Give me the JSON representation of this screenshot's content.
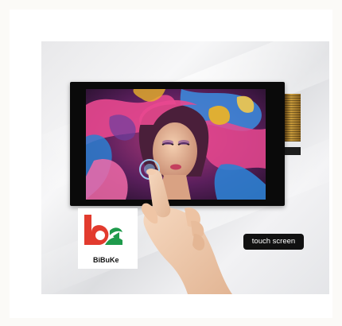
{
  "brand": {
    "name": "BiBuKe",
    "colors": {
      "red": "#e23b2e",
      "green": "#1e9a4b"
    }
  },
  "badge": {
    "label": "touch screen"
  },
  "image": {
    "subject": "lcd-touch-display-product-photo",
    "colors": {
      "bezel": "#0a0a0a",
      "skin": "#f0c9a8",
      "pink": "#e8488f",
      "blue": "#2d7fd1",
      "gold": "#e8b22a",
      "violet": "#6b3fa0"
    }
  }
}
